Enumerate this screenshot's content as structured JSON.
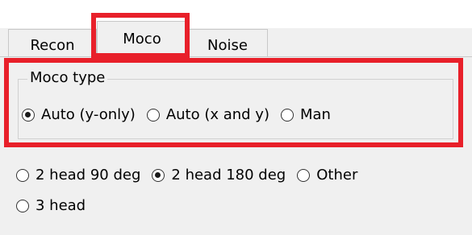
{
  "tabs": [
    {
      "label": "Recon",
      "active": false
    },
    {
      "label": "Moco",
      "active": true
    },
    {
      "label": "Noise",
      "active": false
    }
  ],
  "moco_group": {
    "title": "Moco type",
    "options": [
      {
        "label": "Auto (y-only)",
        "checked": true
      },
      {
        "label": "Auto (x and y)",
        "checked": false
      },
      {
        "label": "Man",
        "checked": false
      }
    ]
  },
  "head_options": [
    {
      "label": "2 head 90 deg",
      "checked": false
    },
    {
      "label": "2 head 180 deg",
      "checked": true
    },
    {
      "label": "Other",
      "checked": false
    },
    {
      "label": "3 head",
      "checked": false
    }
  ],
  "colors": {
    "highlight": "#e8202a",
    "background": "#f0f0f0"
  }
}
